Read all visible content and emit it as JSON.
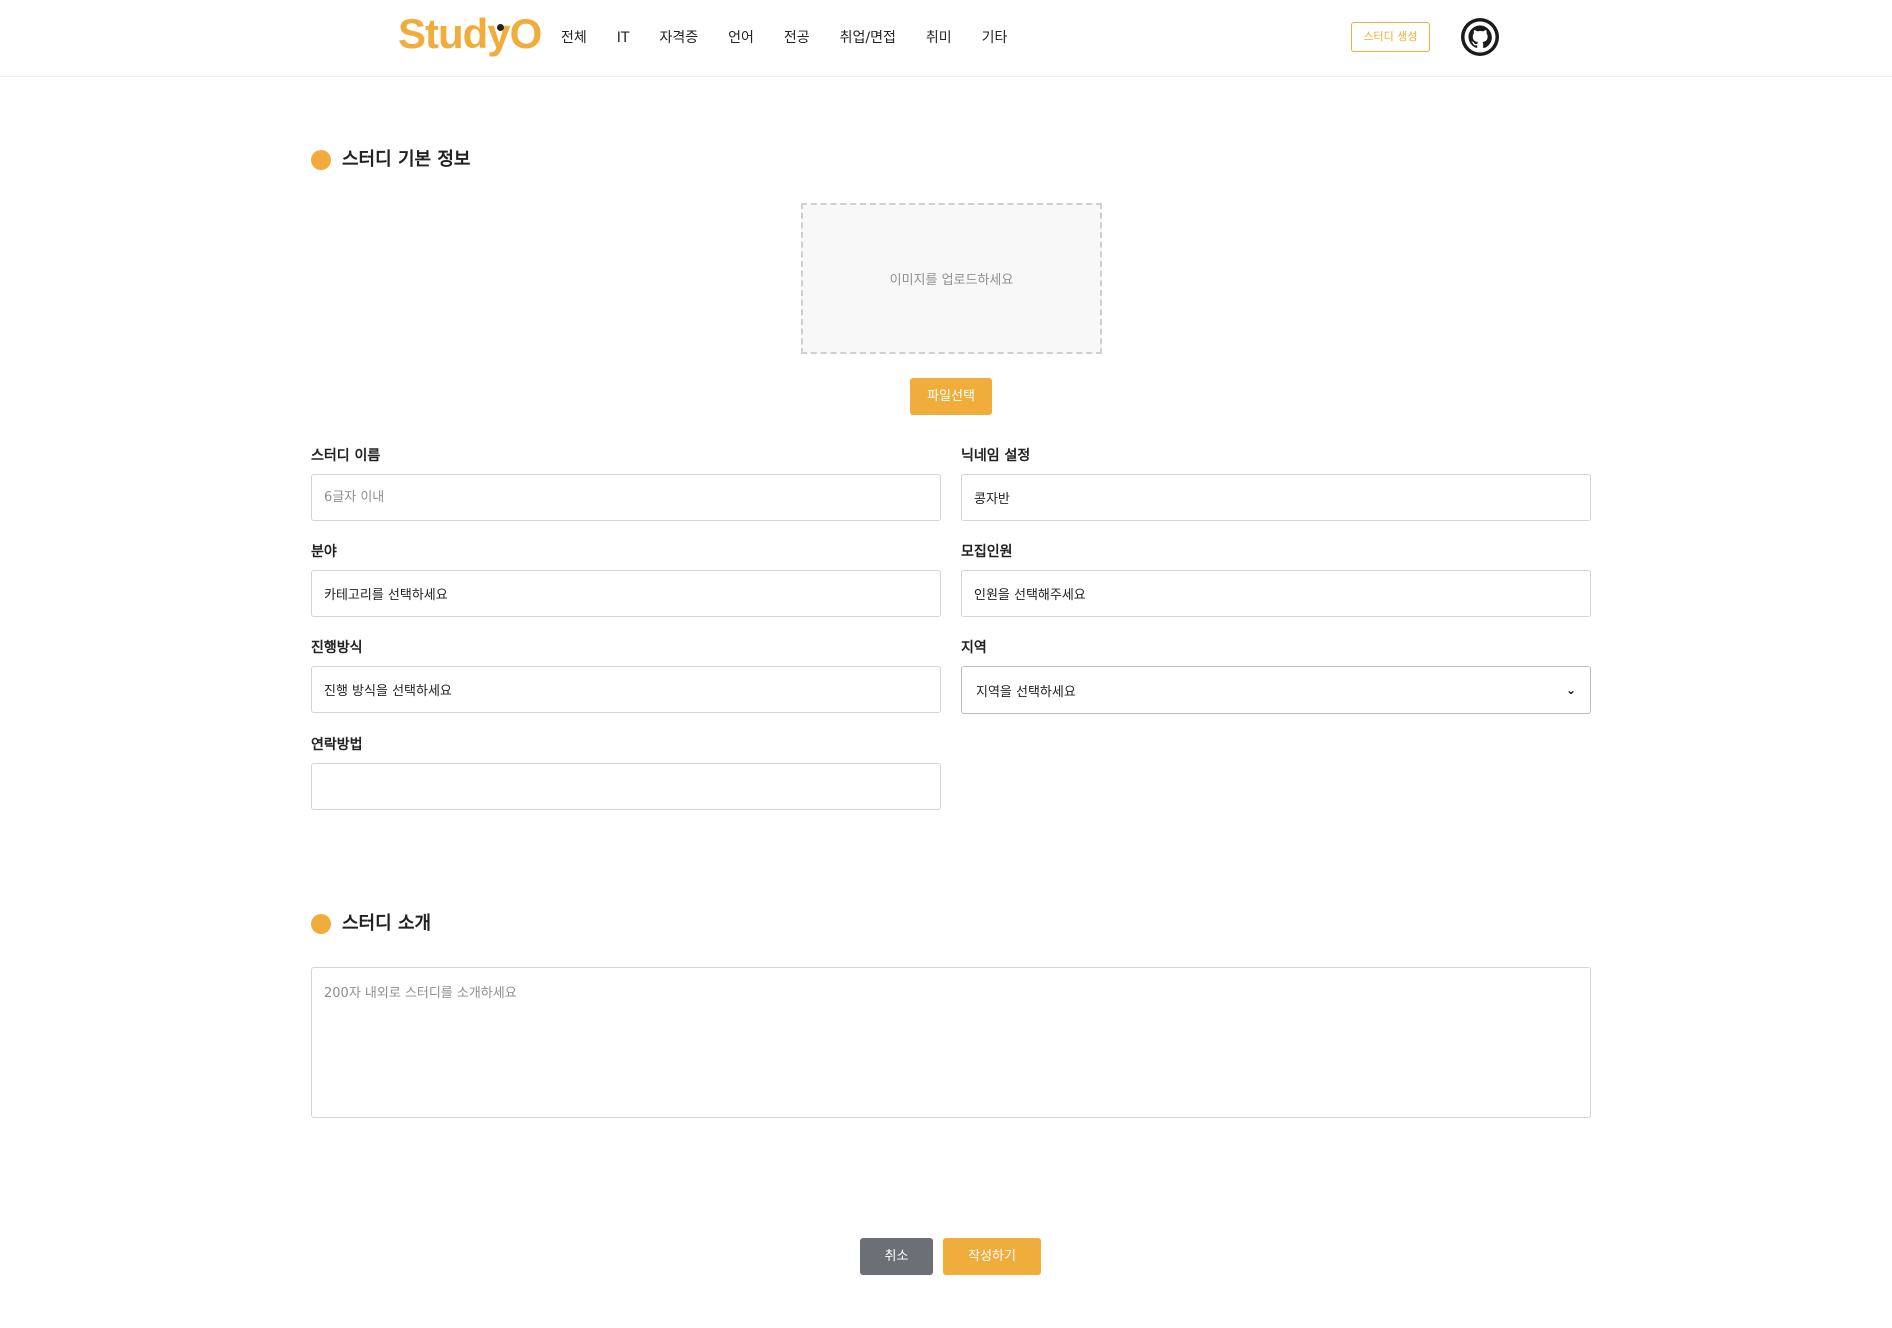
{
  "header": {
    "logo_text": "StudyO",
    "nav": [
      "전체",
      "IT",
      "자격증",
      "언어",
      "전공",
      "취업/면접",
      "취미",
      "기타"
    ],
    "create_study_label": "스터디 생성",
    "github_icon": "github-icon"
  },
  "basic_info": {
    "section_title": "스터디 기본 정보",
    "upload_placeholder": "이미지를 업로드하세요",
    "file_button_label": "파일선택",
    "study_name": {
      "label": "스터디 이름",
      "placeholder": "6글자 이내",
      "value": ""
    },
    "nickname": {
      "label": "닉네임 설정",
      "value": "콩자반"
    },
    "category": {
      "label": "분야",
      "value": "카테고리를 선택하세요"
    },
    "recruit": {
      "label": "모집인원",
      "value": "인원을 선택해주세요"
    },
    "method": {
      "label": "진행방식",
      "value": "진행 방식을 선택하세요"
    },
    "region": {
      "label": "지역",
      "selected": "지역을 선택하세요"
    },
    "contact": {
      "label": "연락방법",
      "value": ""
    }
  },
  "intro": {
    "section_title": "스터디 소개",
    "placeholder": "200자 내외로 스터디를 소개하세요"
  },
  "actions": {
    "cancel_label": "취소",
    "submit_label": "작성하기"
  },
  "colors": {
    "accent": "#f0ad3c",
    "cancel": "#6c7076"
  }
}
